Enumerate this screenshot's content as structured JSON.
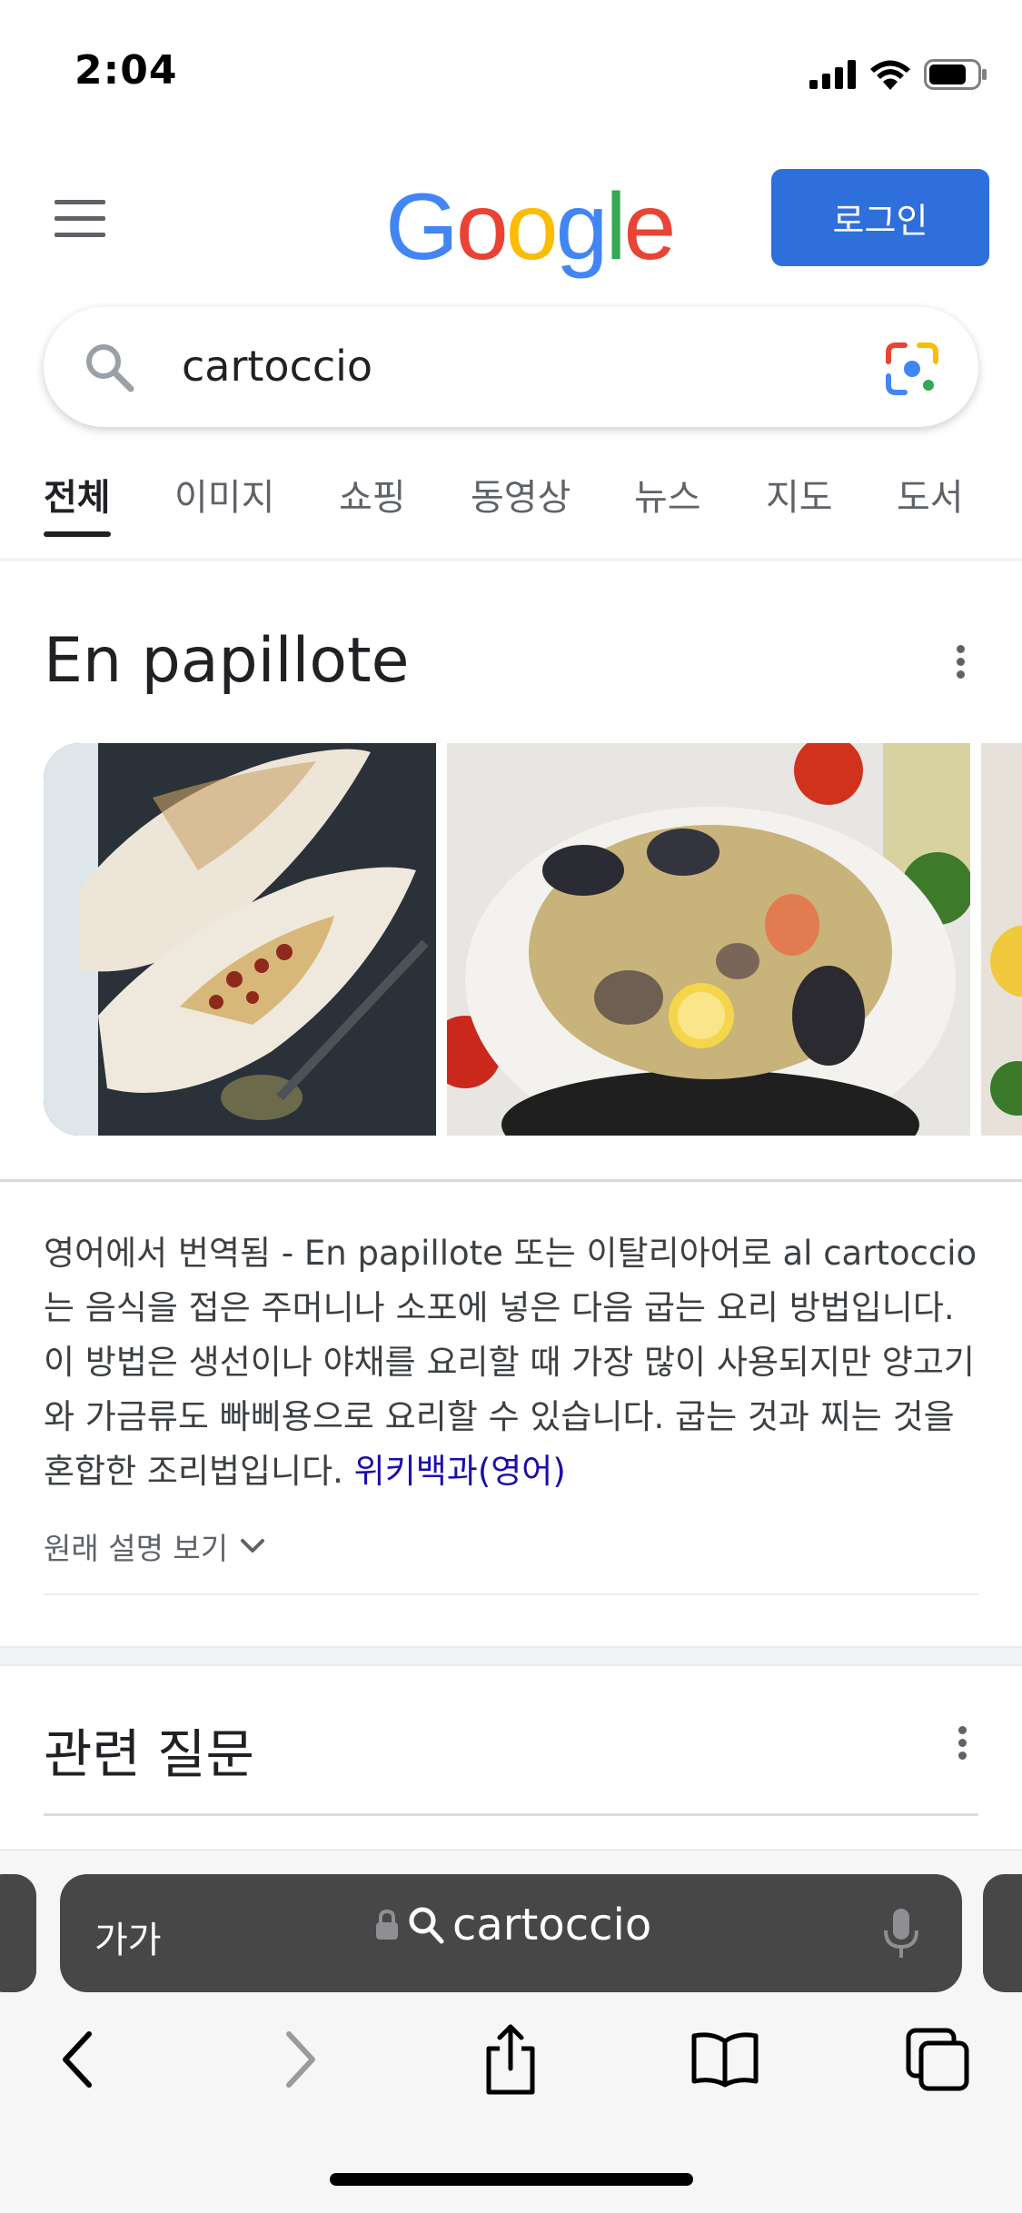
{
  "status_bar": {
    "time": "2:04"
  },
  "header": {
    "logo": {
      "letters": [
        "G",
        "o",
        "o",
        "g",
        "l",
        "e"
      ],
      "colors": [
        "#4285F4",
        "#EA4335",
        "#FBBC05",
        "#4285F4",
        "#34A853",
        "#EA4335"
      ]
    },
    "login_label": "로그인"
  },
  "search": {
    "query": "cartoccio"
  },
  "tabs": [
    {
      "label": "전체",
      "active": true
    },
    {
      "label": "이미지"
    },
    {
      "label": "쇼핑"
    },
    {
      "label": "동영상"
    },
    {
      "label": "뉴스"
    },
    {
      "label": "지도"
    },
    {
      "label": "도서"
    }
  ],
  "knowledge_panel": {
    "title": "En papillote",
    "images": [
      "fish-in-parchment-image",
      "seafood-pasta-in-parchment-image",
      "partial-dish-image"
    ],
    "description": "영어에서 번역됨 - En papillote 또는 이탈리아어로 al cartoccio는 음식을 접은 주머니나 소포에 넣은 다음 굽는 요리 방법입니다. 이 방법은 생선이나 야채를 요리할 때 가장 많이 사용되지만 양고기와 가금류도 빠삐용으로 요리할 수 있습니다. 굽는 것과 찌는 것을 혼합한 조리법입니다.",
    "source_link": "위키백과(영어)",
    "original_toggle": "원래 설명 보기"
  },
  "related_questions": {
    "title": "관련 질문"
  },
  "safari": {
    "text_size_label": "가가",
    "address_text": "cartoccio",
    "toolbar": [
      "back-icon",
      "forward-icon",
      "share-icon",
      "bookmarks-icon",
      "tabs-icon"
    ]
  },
  "colors": {
    "accent": "#2f6fdc",
    "link": "#1a0dab",
    "address_bar": "#474747"
  }
}
